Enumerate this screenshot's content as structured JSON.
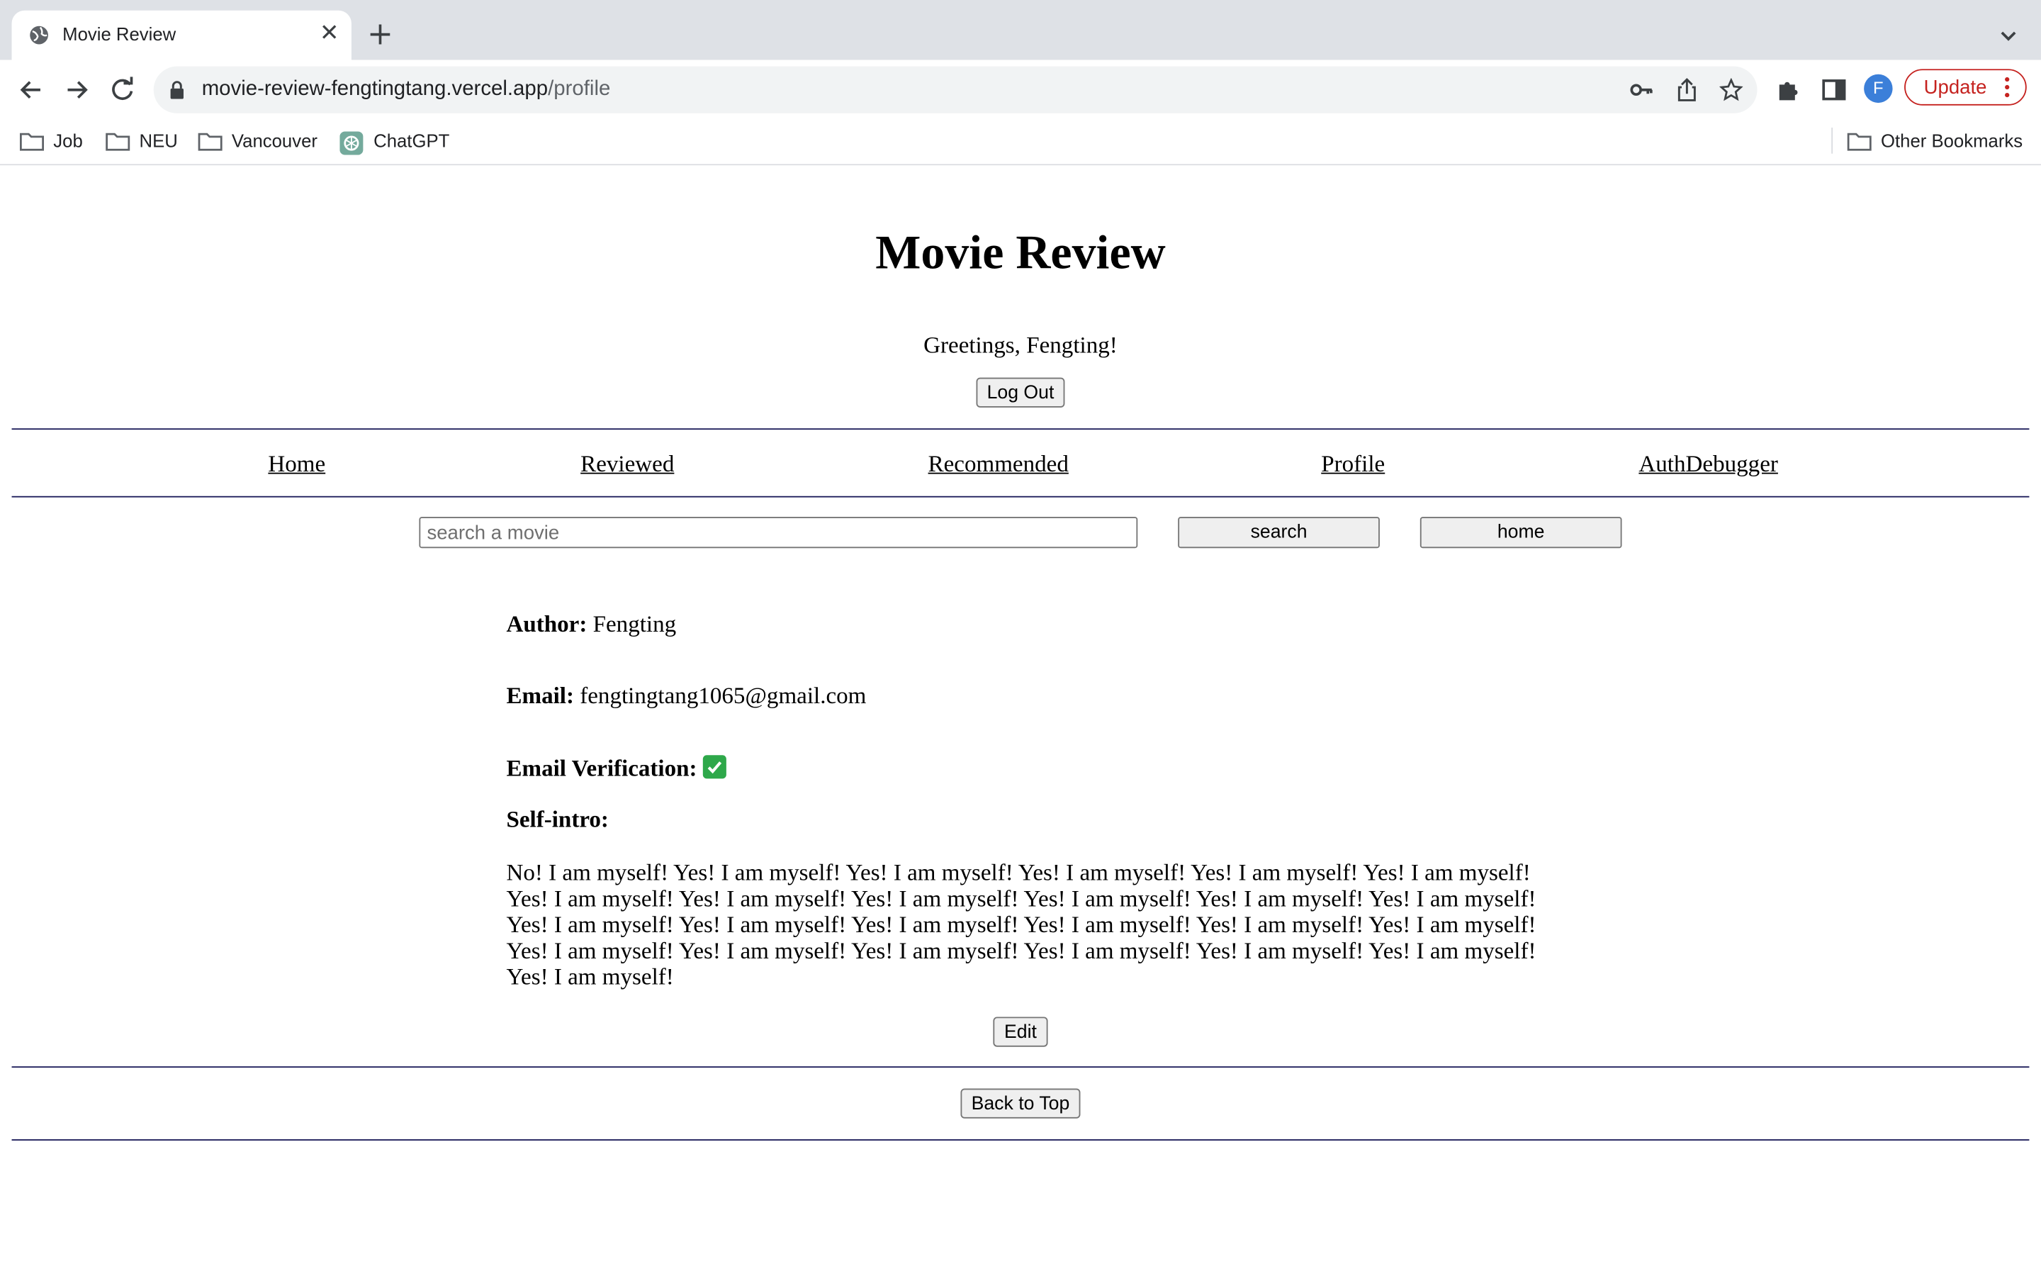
{
  "browser": {
    "tab_title": "Movie Review",
    "url_host": "movie-review-fengtingtang.vercel.app",
    "url_path": "/profile",
    "avatar_letter": "F",
    "update_label": "Update",
    "bookmarks": [
      "Job",
      "NEU",
      "Vancouver",
      "ChatGPT"
    ],
    "other_bookmarks": "Other Bookmarks"
  },
  "app": {
    "title": "Movie Review",
    "greeting": "Greetings, Fengting!",
    "logout_label": "Log Out"
  },
  "nav": {
    "items": [
      "Home",
      "Reviewed",
      "Recommended",
      "Profile",
      "AuthDebugger"
    ]
  },
  "search": {
    "placeholder": "search a movie",
    "value": "",
    "search_label": "search",
    "home_label": "home"
  },
  "profile": {
    "author_label": "Author:",
    "author": "Fengting",
    "email_label": "Email:",
    "email": "fengtingtang1065@gmail.com",
    "verification_label": "Email Verification:",
    "verified": true,
    "intro_label": "Self-intro:",
    "intro": "No! I am myself! Yes! I am myself! Yes! I am myself! Yes! I am myself! Yes! I am myself! Yes! I am myself! Yes! I am myself! Yes! I am myself! Yes! I am myself! Yes! I am myself! Yes! I am myself! Yes! I am myself! Yes! I am myself! Yes! I am myself! Yes! I am myself! Yes! I am myself! Yes! I am myself! Yes! I am myself! Yes! I am myself! Yes! I am myself! Yes! I am myself! Yes! I am myself! Yes! I am myself! Yes! I am myself! Yes! I am myself!",
    "edit_label": "Edit"
  },
  "footer": {
    "back_to_top_label": "Back to Top"
  },
  "colors": {
    "tabbar_bg": "#dee1e6",
    "omnibox_bg": "#f1f3f4",
    "update_red": "#c5221f",
    "divider_navy": "#1c1c5a",
    "verified_green": "#2ea84a",
    "avatar_blue": "#3b7fd9"
  }
}
